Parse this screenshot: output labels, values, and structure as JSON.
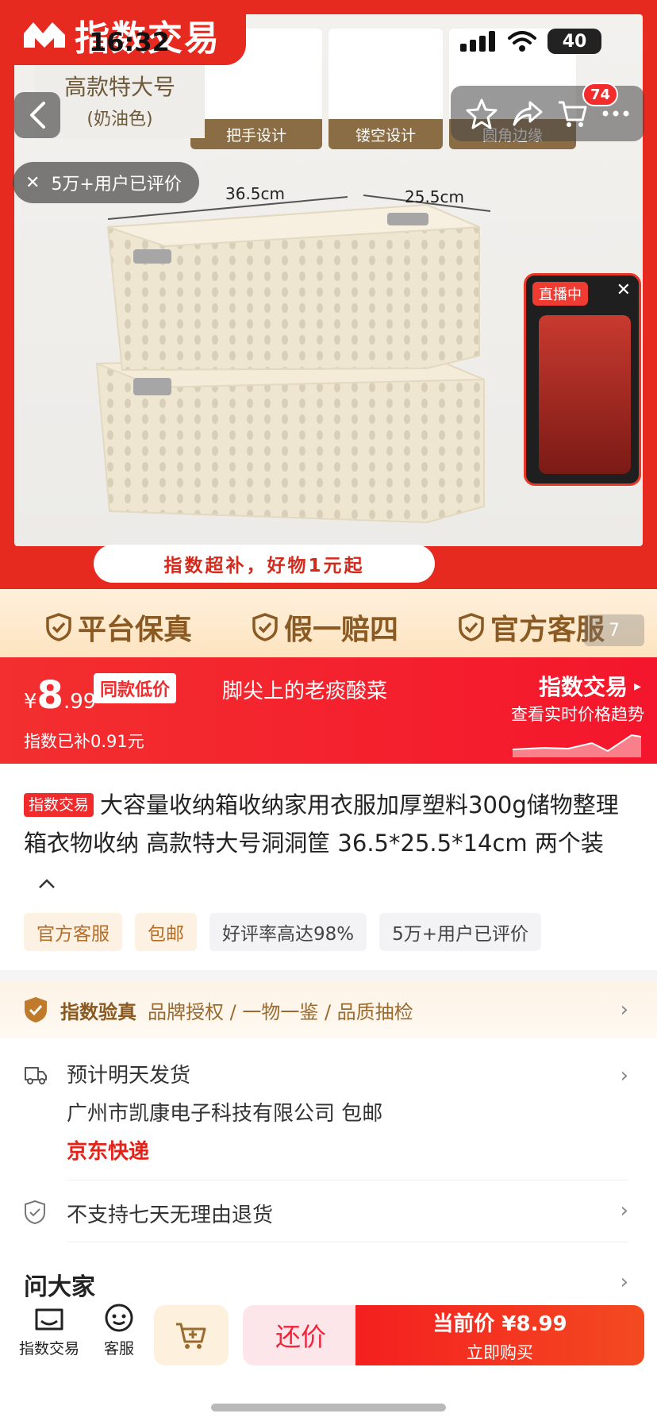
{
  "status": {
    "time": "16:32",
    "battery": "40"
  },
  "brand": {
    "name": "指数交易"
  },
  "hero": {
    "thumbs": [
      "把手设计",
      "镂空设计",
      "圆角边缘"
    ],
    "variant_card": {
      "line1": "高款特大号",
      "line2": "(奶油色)"
    },
    "cart_count": "74",
    "review_chip": "5万+用户已评价",
    "dim_length": "36.5cm",
    "dim_width": "25.5cm",
    "live_label": "直播中",
    "promo": "指数超补，好物1元起"
  },
  "trust": {
    "items": [
      "平台保真",
      "假一赔四",
      "官方客服"
    ],
    "pager": "7"
  },
  "price": {
    "yen": "¥",
    "int": "8",
    "dec": ".99",
    "tag": "同款低价",
    "shop": "脚尖上的老痰酸菜",
    "index_brand": "指数交易",
    "index_sub": "查看实时价格趋势",
    "subsidy": "指数已补0.91元"
  },
  "product": {
    "badge": "指数交易",
    "title": "大容量收纳箱收纳家用衣服加厚塑料300g储物整理箱衣物收纳 高款特大号洞洞筐 36.5*25.5*14cm 两个装",
    "tags": [
      "官方客服",
      "包邮",
      "好评率高达98%",
      "5万+用户已评价"
    ]
  },
  "verify": {
    "title": "指数验真",
    "sub": "品牌授权 / 一物一鉴 / 品质抽检"
  },
  "shipping": {
    "line1": "预计明天发货",
    "line2": "广州市凯康电子科技有限公司  包邮",
    "line3": "京东快递"
  },
  "returns": {
    "text": "不支持七天无理由退货"
  },
  "ask": {
    "title": "问大家"
  },
  "bottom": {
    "home_label": "指数交易",
    "service_label": "客服",
    "bargain": "还价",
    "buy_line1": "当前价 ¥8.99",
    "buy_line2": "立即购买"
  },
  "colors": {
    "accent": "#e62a1f",
    "gold": "#8b5a23"
  }
}
